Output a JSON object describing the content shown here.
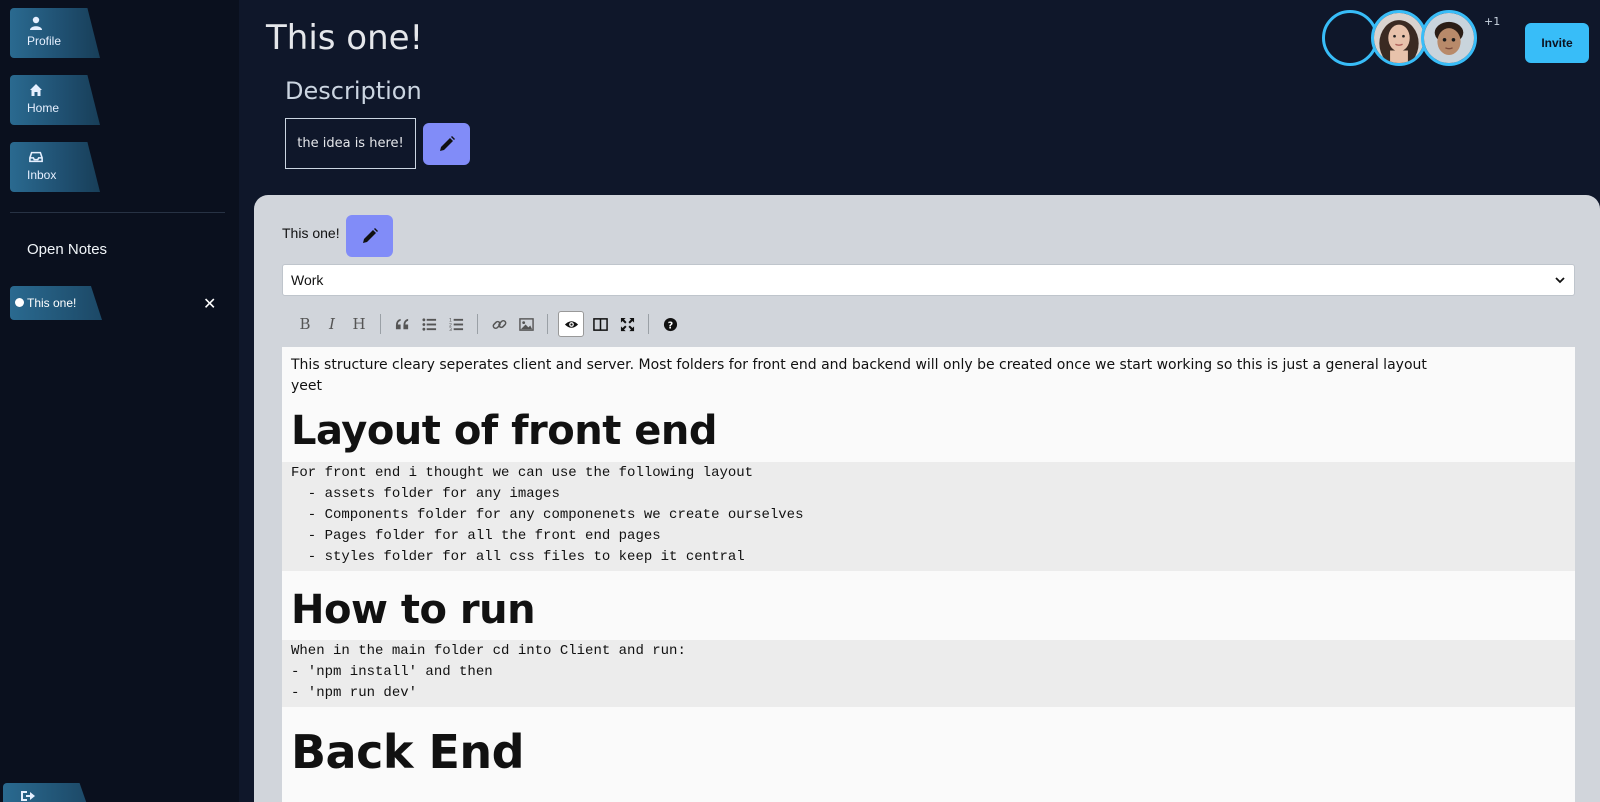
{
  "sidebar": {
    "nav": [
      {
        "label": "Profile",
        "icon": "user-icon"
      },
      {
        "label": "Home",
        "icon": "home-icon"
      },
      {
        "label": "Inbox",
        "icon": "inbox-icon"
      }
    ],
    "open_notes_heading": "Open Notes",
    "open_notes": [
      {
        "label": "This one!"
      }
    ],
    "logout_icon": "sign-out-icon"
  },
  "header": {
    "title": "This one!",
    "description_heading": "Description",
    "description_value": "the idea is here!",
    "collaborators_extra": "+1",
    "invite_label": "Invite"
  },
  "note": {
    "title": "This one!",
    "category": "Work",
    "toolbar": [
      {
        "name": "bold",
        "label": "B"
      },
      {
        "name": "italic",
        "label": "I"
      },
      {
        "name": "heading",
        "label": "H"
      },
      {
        "name": "quote",
        "icon": "quote-icon"
      },
      {
        "name": "unordered-list",
        "icon": "list-ul-icon"
      },
      {
        "name": "ordered-list",
        "icon": "list-ol-icon"
      },
      {
        "name": "link",
        "icon": "link-icon"
      },
      {
        "name": "image",
        "icon": "image-icon"
      },
      {
        "name": "preview",
        "icon": "eye-icon",
        "active": true
      },
      {
        "name": "side-by-side",
        "icon": "columns-icon"
      },
      {
        "name": "fullscreen",
        "icon": "expand-icon"
      },
      {
        "name": "guide",
        "icon": "question-icon"
      }
    ],
    "content": {
      "intro_line1": "This structure cleary seperates client and server. Most folders for front end and backend will only be created once we start working so this is just a general layout",
      "intro_line2": "yeet",
      "h1_front": "Layout of front end",
      "code_front": "For front end i thought we can use the following layout\n  - assets folder for any images\n  - Components folder for any componenets we create ourselves\n  - Pages folder for all the front end pages\n  - styles folder for all css files to keep it central",
      "h1_run": "How to run",
      "code_run": "When in the main folder cd into Client and run:\n- 'npm install' and then\n- 'npm run dev'",
      "h1_back": "Back End"
    }
  },
  "colors": {
    "accent": "#38bdf8",
    "edit_button": "#818cf8",
    "background": "#0f172a",
    "sidebar": "#0a101e",
    "panel": "#d1d5db"
  }
}
